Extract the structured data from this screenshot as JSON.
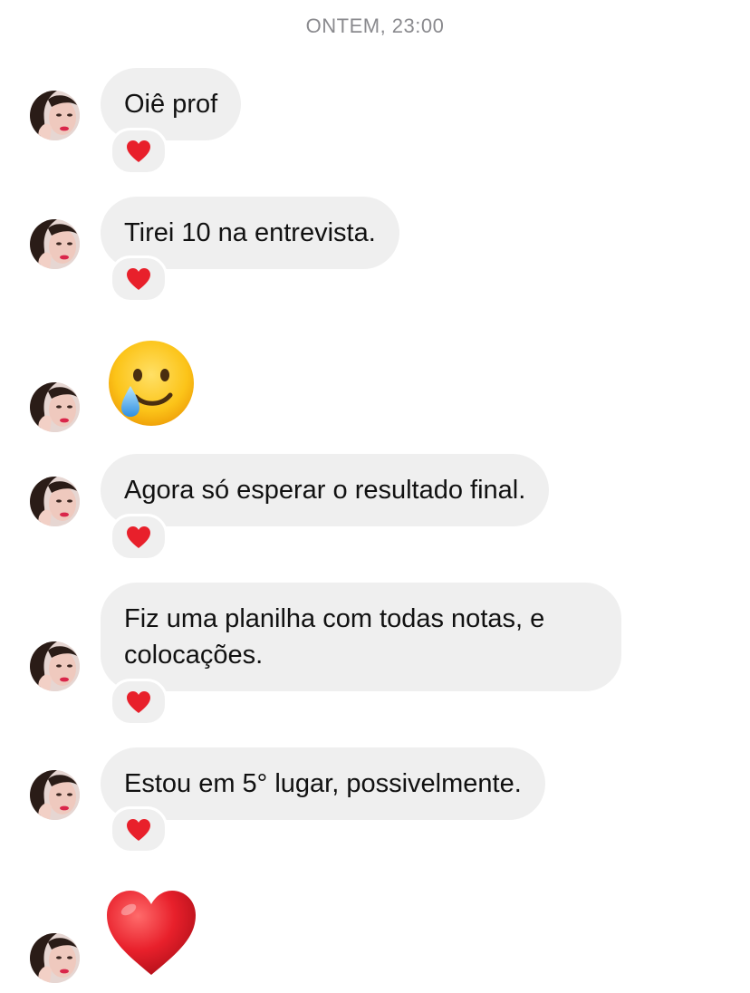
{
  "conversation": {
    "timestamp": "ONTEM, 23:00",
    "messages": [
      {
        "type": "text",
        "text": "Oiê prof",
        "reaction": "heart"
      },
      {
        "type": "text",
        "text": "Tirei 10 na entrevista.",
        "reaction": "heart"
      },
      {
        "type": "emoji",
        "emoji": "smiling-face-with-tear"
      },
      {
        "type": "text",
        "text": "Agora só esperar o resultado final.",
        "reaction": "heart"
      },
      {
        "type": "text",
        "text": "Fiz uma planilha com todas notas, e\ncolocações.",
        "reaction": "heart"
      },
      {
        "type": "text",
        "text": "Estou em 5° lugar, possivelmente.",
        "reaction": "heart"
      },
      {
        "type": "emoji",
        "emoji": "red-heart"
      }
    ]
  },
  "colors": {
    "bubble": "#efefef",
    "timestamp": "#8a8a8e",
    "heart": "#e8202b",
    "text": "#111111"
  }
}
